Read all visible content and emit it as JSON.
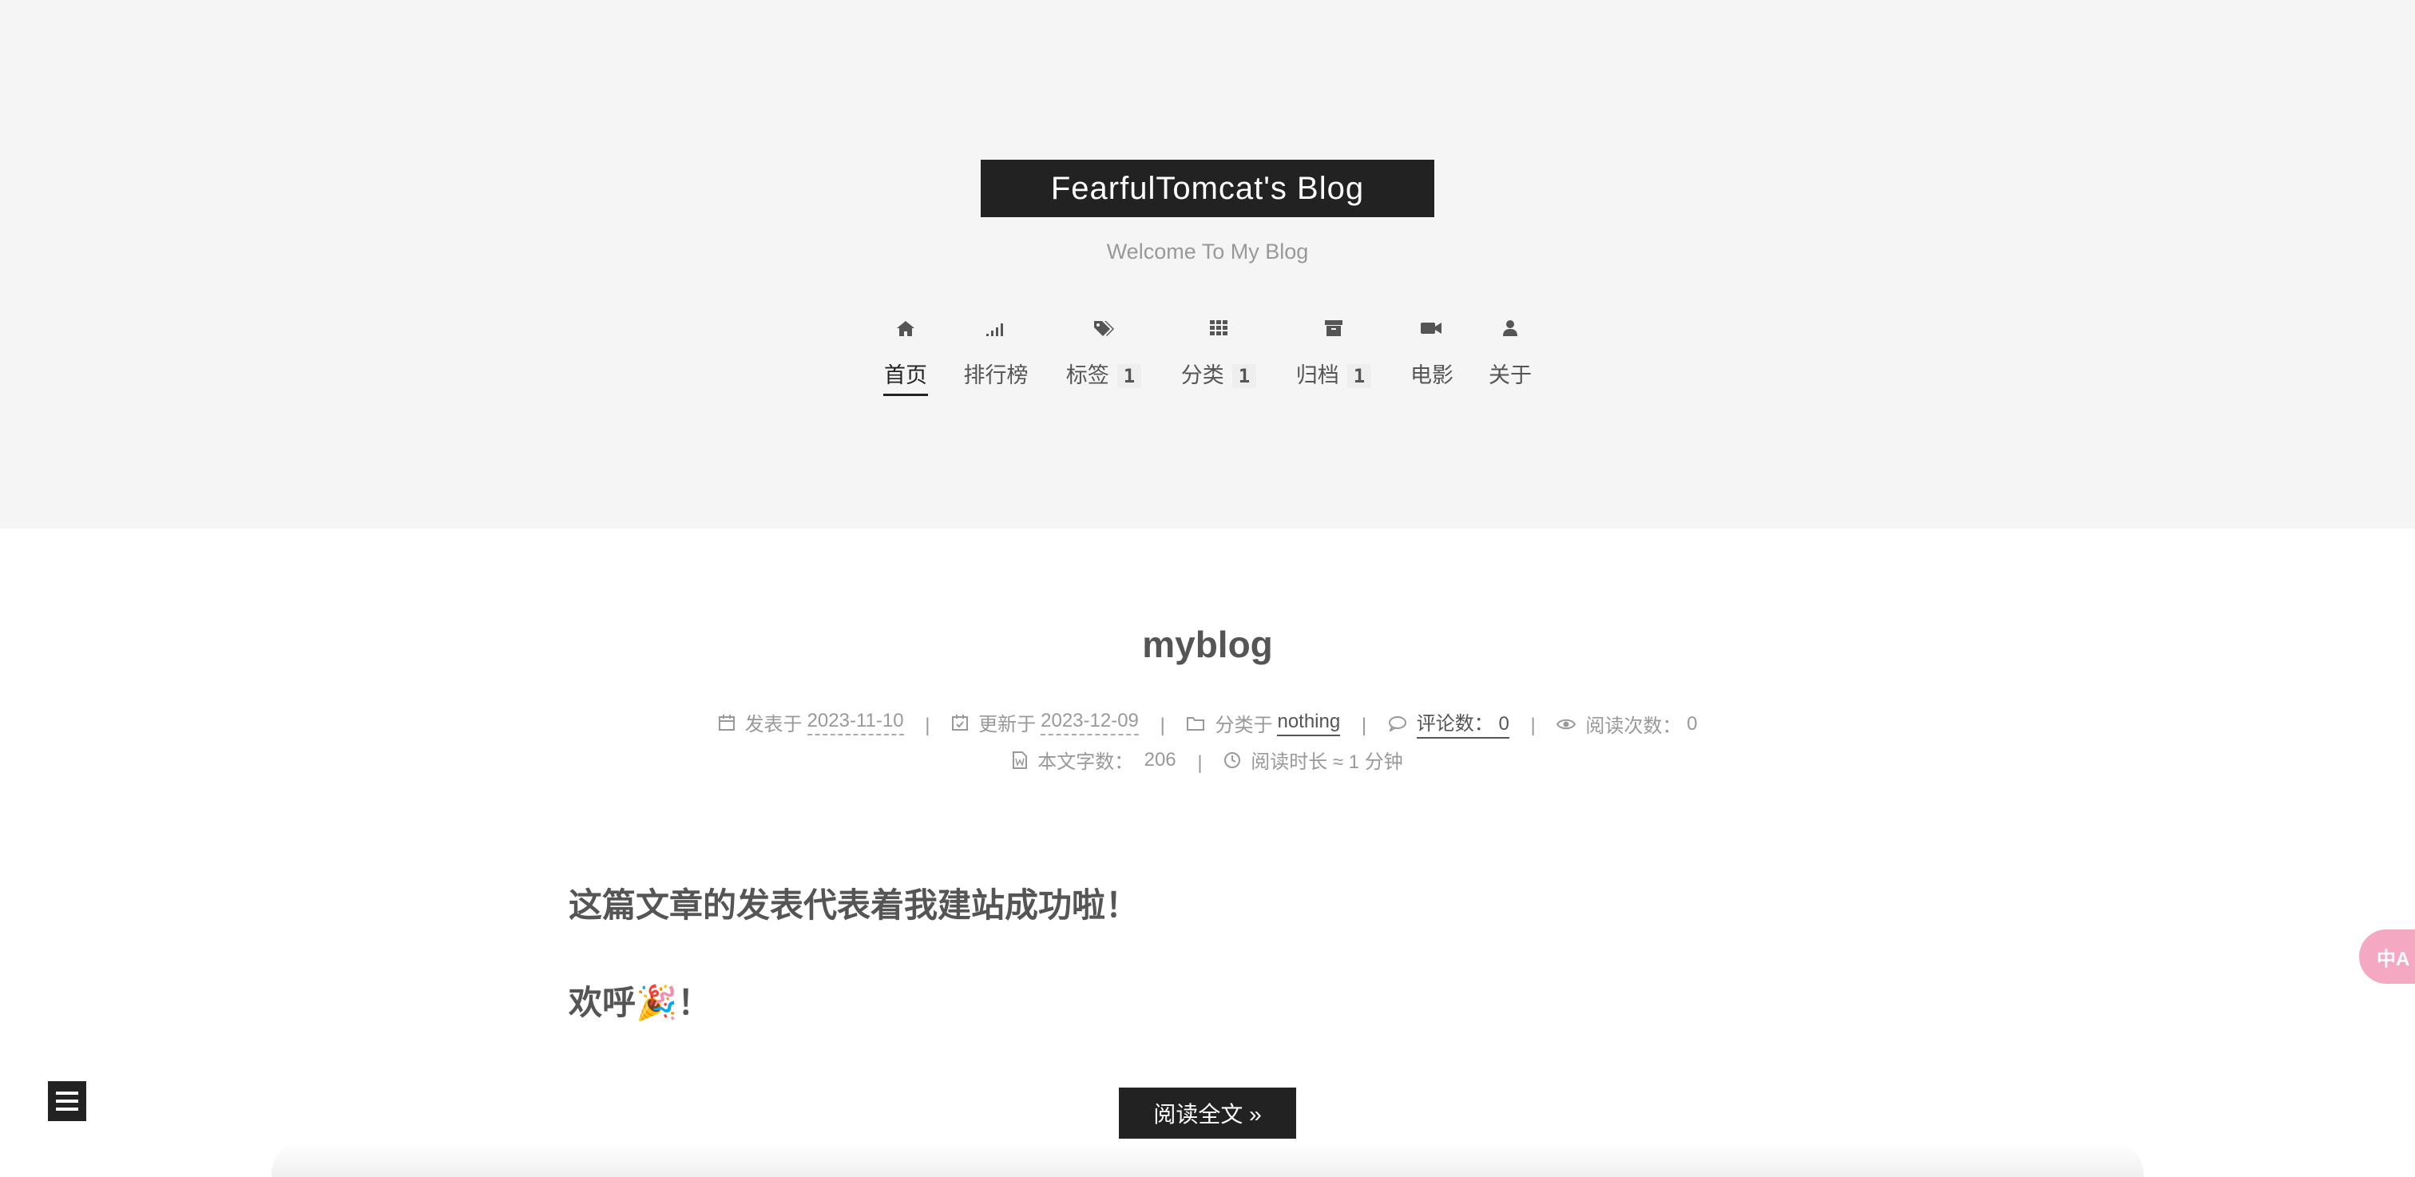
{
  "site": {
    "title": "FearfulTomcat's Blog",
    "subtitle": "Welcome To My Blog"
  },
  "nav": {
    "items": [
      {
        "label": "首页",
        "icon": "home-icon",
        "active": true
      },
      {
        "label": "排行榜",
        "icon": "signal-icon"
      },
      {
        "label": "标签",
        "icon": "tags-icon",
        "badge": "1"
      },
      {
        "label": "分类",
        "icon": "grid-icon",
        "badge": "1"
      },
      {
        "label": "归档",
        "icon": "archive-icon",
        "badge": "1"
      },
      {
        "label": "电影",
        "icon": "video-icon"
      },
      {
        "label": "关于",
        "icon": "user-icon"
      }
    ]
  },
  "post": {
    "title": "myblog",
    "meta": {
      "posted_label": "发表于",
      "posted_date": "2023-11-10",
      "updated_label": "更新于",
      "updated_date": "2023-12-09",
      "category_label": "分类于",
      "category": "nothing",
      "comments_label": "评论数：",
      "comments_count": "0",
      "views_label": "阅读次数：",
      "views_count": "0",
      "wordcount_label": "本文字数：",
      "wordcount": "206",
      "readtime_label": "阅读时长 ≈",
      "readtime": "1 分钟",
      "separator": "|"
    },
    "content": {
      "line1": "这篇文章的发表代表着我建站成功啦！",
      "line2": "欢呼🎉！"
    },
    "read_more": "阅读全文 »"
  },
  "widgets": {
    "translate_label": "中A"
  },
  "colors": {
    "header_bg": "#f5f5f5",
    "brand_bg": "#222222",
    "text": "#555555",
    "muted": "#999999",
    "translate_accent": "#f4a8c2"
  }
}
